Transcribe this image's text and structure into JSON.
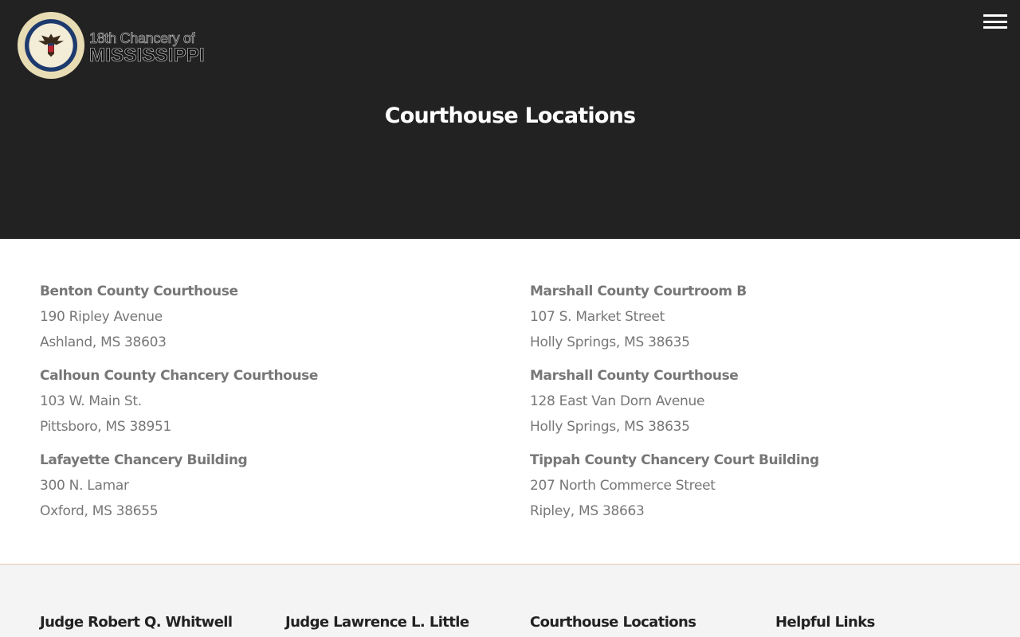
{
  "header": {
    "logo": {
      "line1": "18th Chancery of",
      "line2": "MISSISSIPPI"
    },
    "menu_icon": "hamburger-menu-icon",
    "title": "Courthouse Locations"
  },
  "locations": {
    "left": [
      {
        "name": "Benton County Courthouse",
        "street": "190 Ripley Avenue",
        "city": "Ashland, MS 38603"
      },
      {
        "name": "Calhoun County Chancery Courthouse",
        "street": "103 W. Main St.",
        "city": "Pittsboro, MS 38951"
      },
      {
        "name": "Lafayette Chancery Building",
        "street": "300 N. Lamar",
        "city": "Oxford, MS 38655"
      }
    ],
    "right": [
      {
        "name": "Marshall County Courtroom B",
        "street": "107 S. Market Street",
        "city": "Holly Springs, MS 38635"
      },
      {
        "name": "Marshall County Courthouse",
        "street": "128 East Van Dorn Avenue",
        "city": "Holly Springs, MS 38635"
      },
      {
        "name": "Tippah County Chancery Court Building",
        "street": "207 North Commerce Street",
        "city": "Ripley, MS 38663"
      }
    ]
  },
  "footer": {
    "headings": [
      "Judge Robert Q. Whitwell",
      "Judge Lawrence L. Little",
      "Courthouse Locations",
      "Helpful Links"
    ]
  },
  "colors": {
    "header_bg": "#222222",
    "text_gray": "#777777",
    "footer_bg": "#f4f4f4",
    "footer_border": "#e2c9a8"
  }
}
